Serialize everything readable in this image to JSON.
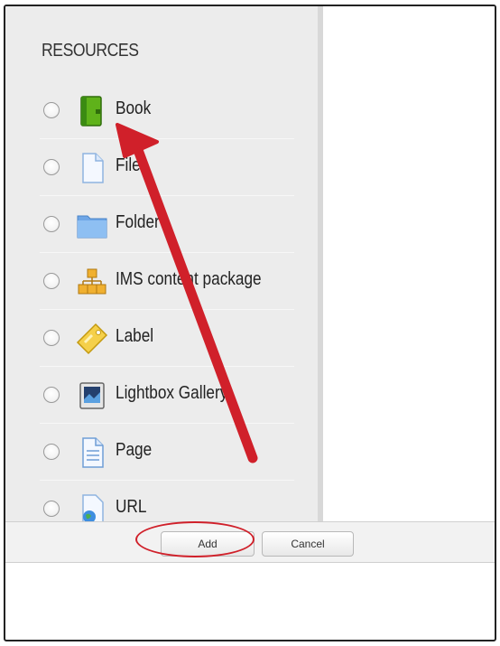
{
  "section": {
    "title": "RESOURCES"
  },
  "items": [
    {
      "label": "Book",
      "icon": "book-icon"
    },
    {
      "label": "File",
      "icon": "file-icon"
    },
    {
      "label": "Folder",
      "icon": "folder-icon"
    },
    {
      "label": "IMS content package",
      "icon": "ims-package-icon"
    },
    {
      "label": "Label",
      "icon": "label-tag-icon"
    },
    {
      "label": "Lightbox Gallery",
      "icon": "lightbox-gallery-icon"
    },
    {
      "label": "Page",
      "icon": "page-icon"
    },
    {
      "label": "URL",
      "icon": "url-icon"
    }
  ],
  "buttons": {
    "add": "Add",
    "cancel": "Cancel"
  },
  "colors": {
    "annotation": "#d0202a",
    "panel": "#ececec"
  }
}
